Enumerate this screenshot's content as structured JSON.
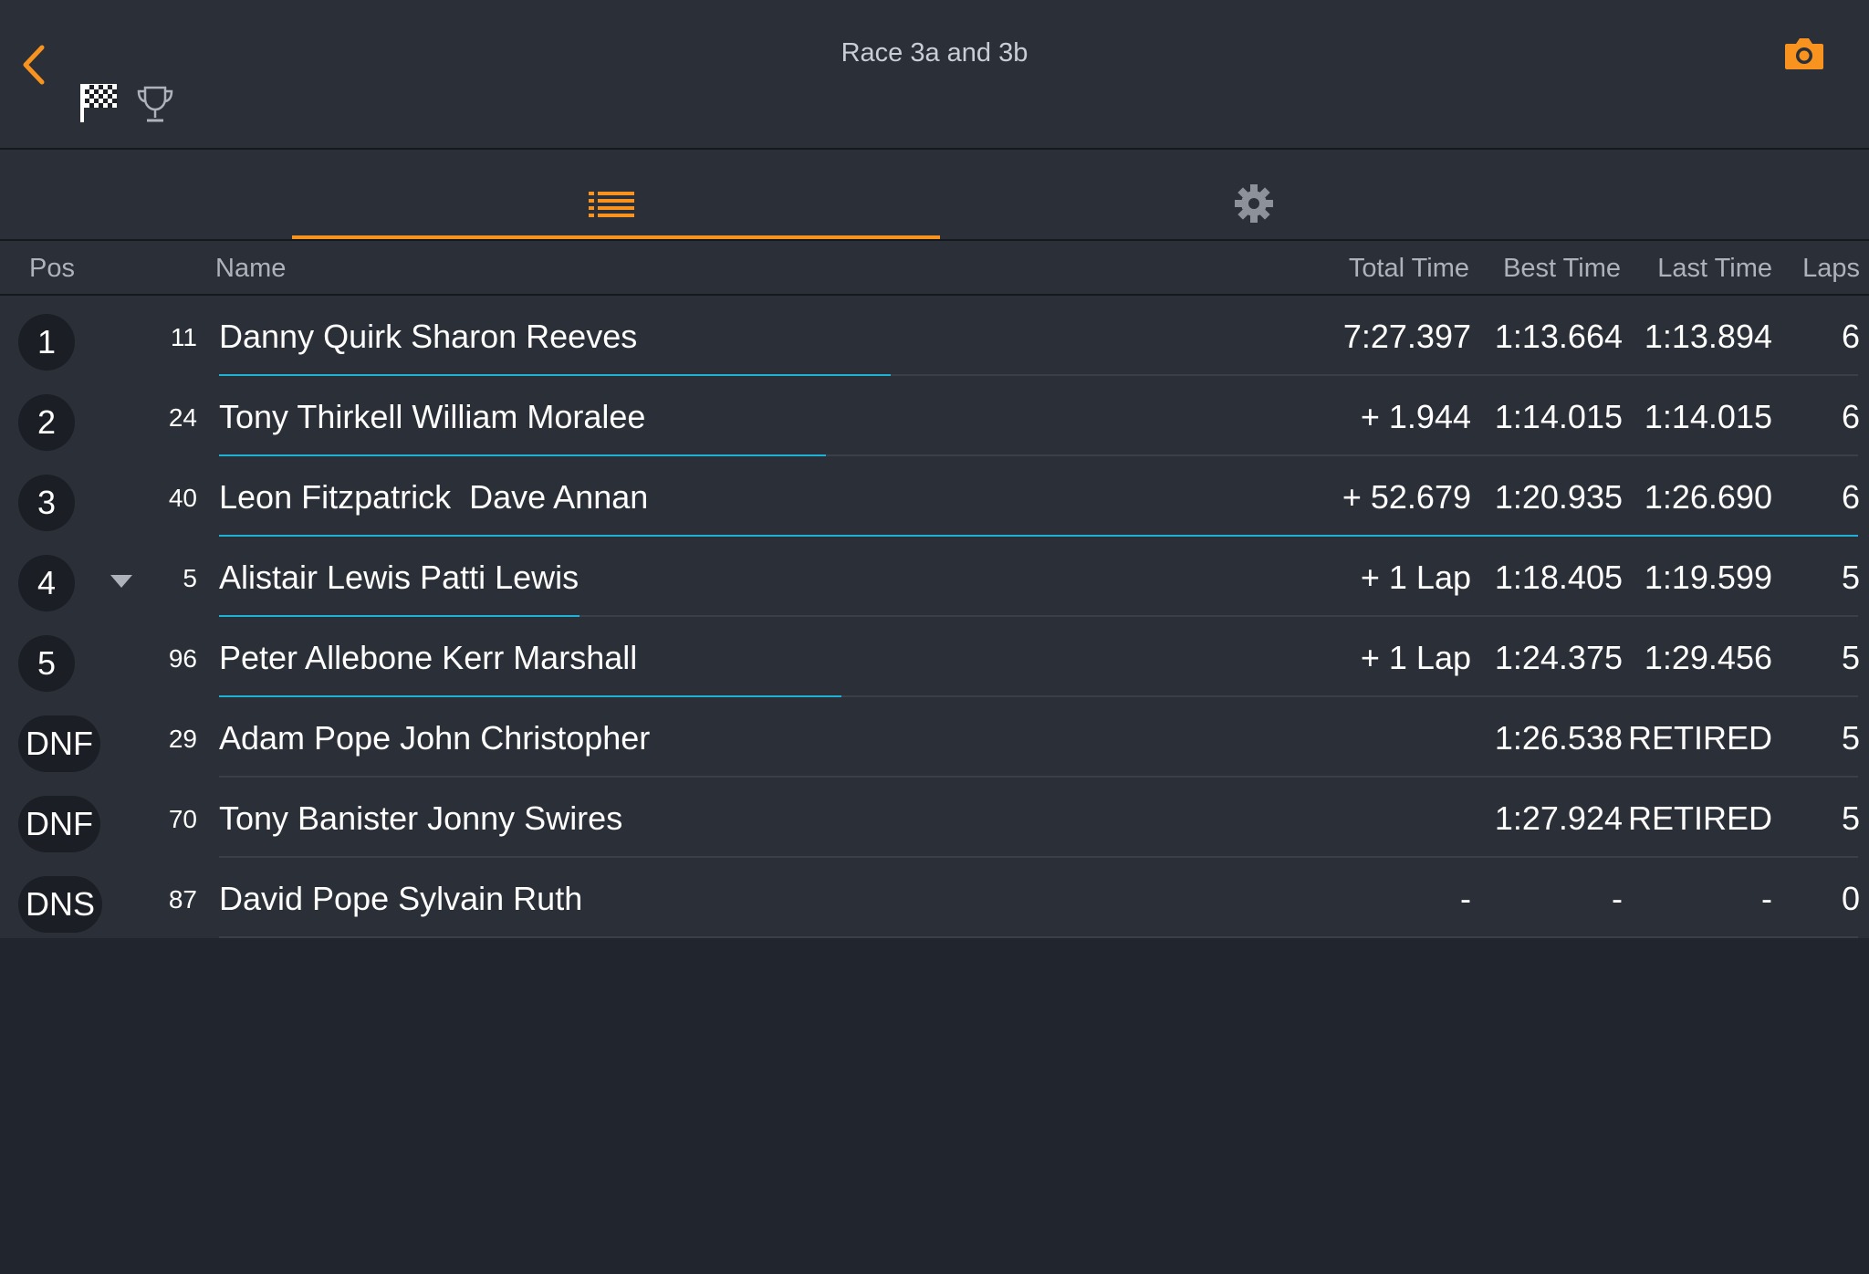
{
  "header": {
    "title": "Race 3a and 3b",
    "accent_color": "#f7931e"
  },
  "tabs": [
    {
      "icon": "list-icon",
      "active": true
    },
    {
      "icon": "gear-icon",
      "active": false
    }
  ],
  "columns": {
    "pos": "Pos",
    "name": "Name",
    "total": "Total Time",
    "best": "Best Time",
    "last": "Last Time",
    "laps": "Laps"
  },
  "rows": [
    {
      "pos": "1",
      "num": "11",
      "name": "Danny Quirk Sharon Reeves",
      "total": "7:27.397",
      "best": "1:13.664",
      "last": "1:13.894",
      "laps": "6",
      "progress": 0.41,
      "arrow": false
    },
    {
      "pos": "2",
      "num": "24",
      "name": "Tony Thirkell William Moralee",
      "total": "+ 1.944",
      "best": "1:14.015",
      "last": "1:14.015",
      "laps": "6",
      "progress": 0.37,
      "arrow": false
    },
    {
      "pos": "3",
      "num": "40",
      "name": "Leon Fitzpatrick  Dave Annan",
      "total": "+ 52.679",
      "best": "1:20.935",
      "last": "1:26.690",
      "laps": "6",
      "progress": 1.0,
      "arrow": false
    },
    {
      "pos": "4",
      "num": "5",
      "name": "Alistair Lewis Patti Lewis",
      "total": "+ 1 Lap",
      "best": "1:18.405",
      "last": "1:19.599",
      "laps": "5",
      "progress": 0.22,
      "arrow": true
    },
    {
      "pos": "5",
      "num": "96",
      "name": "Peter Allebone Kerr Marshall",
      "total": "+ 1 Lap",
      "best": "1:24.375",
      "last": "1:29.456",
      "laps": "5",
      "progress": 0.38,
      "arrow": false
    },
    {
      "pos": "DNF",
      "num": "29",
      "name": "Adam Pope John Christopher",
      "total": "",
      "best": "1:26.538",
      "last": "RETIRED",
      "laps": "5",
      "progress": 0,
      "arrow": false
    },
    {
      "pos": "DNF",
      "num": "70",
      "name": "Tony Banister Jonny Swires",
      "total": "",
      "best": "1:27.924",
      "last": "RETIRED",
      "laps": "5",
      "progress": 0,
      "arrow": false
    },
    {
      "pos": "DNS",
      "num": "87",
      "name": "David Pope Sylvain Ruth",
      "total": "-",
      "best": "-",
      "last": "-",
      "laps": "0",
      "progress": 0,
      "arrow": false
    }
  ]
}
